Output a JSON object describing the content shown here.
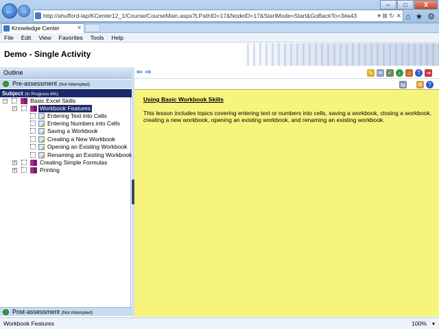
{
  "browser": {
    "address": "http://ahufford-lap/KCenter12_1/Course/CourseMain.aspx?LPathID=17&NodeID=17&StartMode=Start&GoBackTo=3#a43",
    "tab_title": "Knowledge Center",
    "menu": [
      "File",
      "Edit",
      "View",
      "Favorites",
      "Tools",
      "Help"
    ],
    "window_controls": [
      "–",
      "□",
      "X"
    ]
  },
  "app": {
    "title": "Demo - Single Activity"
  },
  "outline": {
    "header": "Outline",
    "pre_assessment": {
      "label": "Pre-assessment",
      "status": "(Not Attempted)"
    },
    "subject": {
      "label": "Subject",
      "status": "(In Progress 6%)"
    },
    "tree": [
      {
        "label": "Basic Excel Skills",
        "icon": "book-icon"
      },
      {
        "label": "Workbook Features",
        "icon": "book-icon",
        "selected": true
      },
      {
        "label": "Entering Text into Cells",
        "icon": "page-icon"
      },
      {
        "label": "Entering Numbers into Cells",
        "icon": "page-icon"
      },
      {
        "label": "Saving a Workbook",
        "icon": "page-icon"
      },
      {
        "label": "Creating a New Workbook",
        "icon": "page-icon"
      },
      {
        "label": "Opening an Existing Workbook",
        "icon": "page-icon"
      },
      {
        "label": "Renaming an Existing Workbook",
        "icon": "page-icon"
      },
      {
        "label": "Creating Simple Formulas",
        "icon": "book-icon"
      },
      {
        "label": "Printing",
        "icon": "book-icon"
      }
    ],
    "post_assessment": {
      "label": "Post-assessment",
      "status": "(Not Attempted)"
    }
  },
  "content": {
    "title": "Using Basic Workbook Skills",
    "body": "This lesson includes topics covering entering text or numbers into cells, saving a workbook, closing a workbook, creating a new workbook, opening an existing workbook, and renaming an existing workbook.",
    "background_color": "#f7f47e"
  },
  "status": {
    "text": "Workbook Features",
    "zoom": "100%"
  }
}
